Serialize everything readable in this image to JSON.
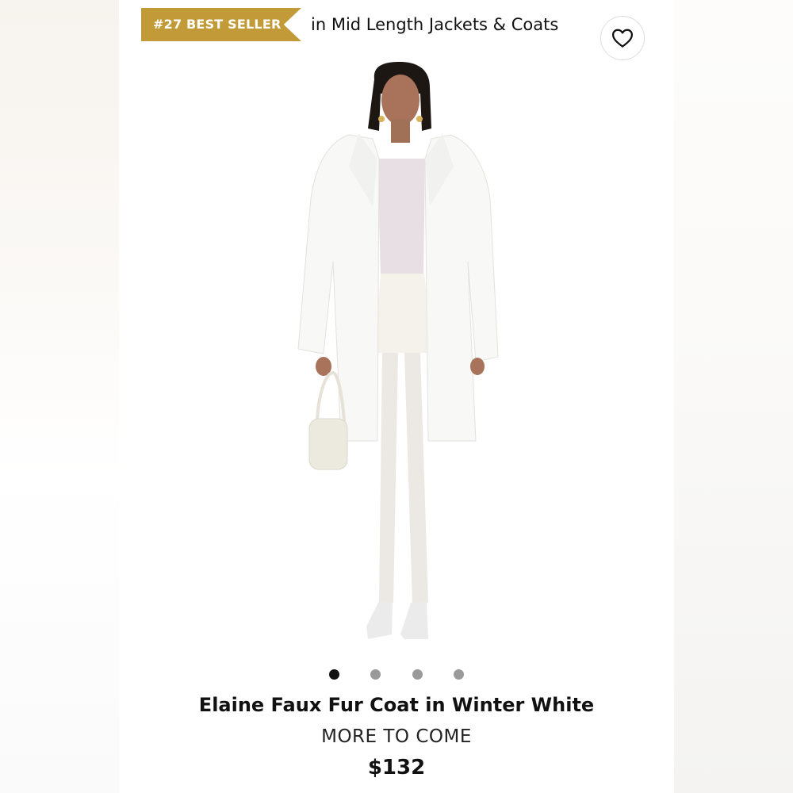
{
  "badge": {
    "rank_label": "#27 BEST SELLER",
    "category_text": "in Mid Length Jackets & Coats"
  },
  "favorite": {
    "icon": "heart-outline-icon"
  },
  "carousel": {
    "count": 4,
    "active_index": 0
  },
  "product": {
    "title": "Elaine Faux Fur Coat in Winter White",
    "brand": "MORE TO COME",
    "price": "$132"
  },
  "colors": {
    "badge_gold": "#c29b38",
    "dot_active": "#111111",
    "dot_inactive": "#9a9a9a"
  }
}
